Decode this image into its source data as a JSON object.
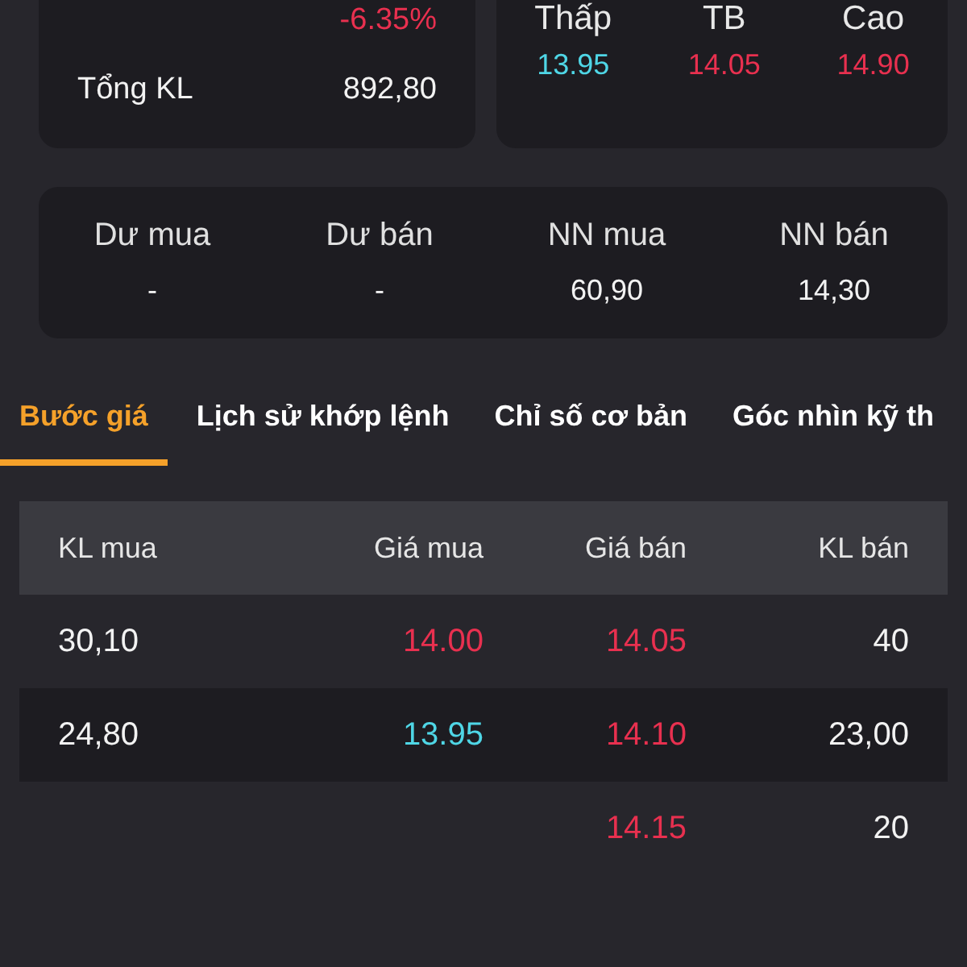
{
  "summary": {
    "change": "-6.35%",
    "total_volume_label": "Tổng KL",
    "total_volume": "892,80"
  },
  "price_range": [
    {
      "label": "Thấp",
      "value": "13.95",
      "color": "#4fd6e6"
    },
    {
      "label": "TB",
      "value": "14.05",
      "color": "#e8304f"
    },
    {
      "label": "Cao",
      "value": "14.90",
      "color": "#e8304f"
    }
  ],
  "trading": [
    {
      "label": "Dư mua",
      "value": "-"
    },
    {
      "label": "Dư bán",
      "value": "-"
    },
    {
      "label": "NN mua",
      "value": "60,90"
    },
    {
      "label": "NN bán",
      "value": "14,30"
    }
  ],
  "tabs": [
    {
      "label": "Bước giá",
      "selected": true
    },
    {
      "label": "Lịch sử khớp lệnh",
      "selected": false
    },
    {
      "label": "Chỉ số cơ bản",
      "selected": false
    },
    {
      "label": "Góc nhìn kỹ th",
      "selected": false
    }
  ],
  "table": {
    "columns": [
      "KL mua",
      "Giá mua",
      "Giá bán",
      "KL bán"
    ],
    "rows": [
      {
        "buy_volume": "30,10",
        "buy_price": {
          "value": "14.00",
          "color": "#e8304f"
        },
        "sell_price": {
          "value": "14.05",
          "color": "#e8304f"
        },
        "sell_volume": "40"
      },
      {
        "buy_volume": "24,80",
        "buy_price": {
          "value": "13.95",
          "color": "#4fd6e6"
        },
        "sell_price": {
          "value": "14.10",
          "color": "#e8304f"
        },
        "sell_volume": "23,00"
      },
      {
        "sell_price": {
          "value": "14.15",
          "color": "#e8304f"
        },
        "sell_volume": "20"
      }
    ]
  }
}
